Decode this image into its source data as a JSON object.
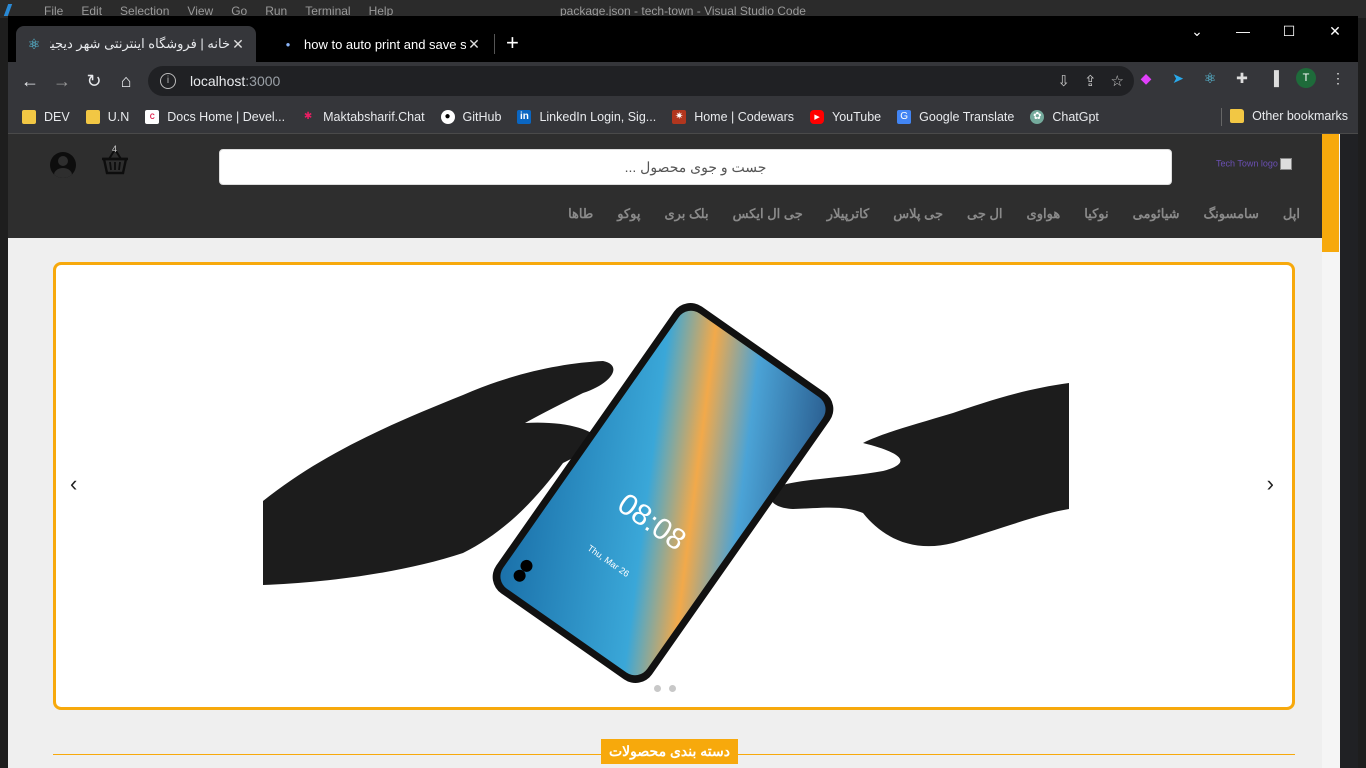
{
  "vscode": {
    "menu": [
      "File",
      "Edit",
      "Selection",
      "View",
      "Go",
      "Run",
      "Terminal",
      "Help"
    ],
    "title": "package.json - tech-town - Visual Studio Code"
  },
  "tabs": {
    "active_title": "خانه | فروشگاه اینترنتی شهر دیجیتال",
    "inactive_title": "how to auto print and save screen"
  },
  "address": {
    "host": "localhost",
    "port": ":3000"
  },
  "bookmarks": [
    {
      "label": "DEV",
      "icon": "folder-icon"
    },
    {
      "label": "U.N",
      "icon": "folder-icon"
    },
    {
      "label": "Docs Home | Devel...",
      "icon": "docs-icon"
    },
    {
      "label": "Maktabsharif.Chat",
      "icon": "chat-icon"
    },
    {
      "label": "GitHub",
      "icon": "github-icon"
    },
    {
      "label": "LinkedIn Login, Sig...",
      "icon": "linkedin-icon"
    },
    {
      "label": "Home | Codewars",
      "icon": "codewars-icon"
    },
    {
      "label": "YouTube",
      "icon": "youtube-icon"
    },
    {
      "label": "Google Translate",
      "icon": "translate-icon"
    },
    {
      "label": "ChatGpt",
      "icon": "chatgpt-icon"
    }
  ],
  "other_bookmarks": "Other bookmarks",
  "profile_initial": "T",
  "site": {
    "search_placeholder": "جست و جوی محصول ...",
    "logo_alt": "Tech Town logo",
    "cart_count": "4",
    "categories": [
      "اپل",
      "سامسونگ",
      "شیائومی",
      "نوکیا",
      "هواوی",
      "ال جی",
      "جی پلاس",
      "کاترپیلار",
      "جی ال ایکس",
      "بلک بری",
      "پوکو",
      "طاها"
    ],
    "section_title": "دسته بندی محصولات"
  },
  "carousel": {
    "phone_time": "08:08",
    "phone_date": "Thu, Mar 26",
    "slide_count": 2
  },
  "colors": {
    "accent": "#f7a90c",
    "header_bg": "#2e2e2e"
  }
}
